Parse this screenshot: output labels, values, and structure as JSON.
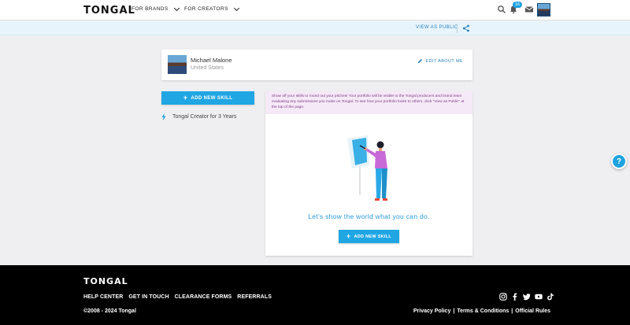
{
  "header": {
    "logo": "TONGAL",
    "menu_brands": "FOR BRANDS",
    "menu_creators": "FOR CREATORS",
    "notification_count": "16",
    "icons": [
      "search-icon",
      "bell-icon",
      "mail-icon",
      "user-avatar"
    ]
  },
  "public_bar": {
    "view_as_public": "VIEW AS PUBLIC",
    "share_icon": "share-icon"
  },
  "profile": {
    "name": "Michael Malone",
    "location": "United States",
    "edit_label": "EDIT ABOUT ME"
  },
  "sidebar": {
    "add_skill_label": "ADD NEW SKILL",
    "tenure": "Tongal Creator for 3 Years"
  },
  "portfolio": {
    "info_text": "Show off your skills to round out your pitches! Your portfolio will be visible to the Tongal producers and brand team evaluating any submissions you make on Tongal. To see how your portfolio looks to others, click \"View as Public\" at the top of the page.",
    "tagline": "Let's show the world what you can do.",
    "add_skill_label": "ADD NEW SKILL"
  },
  "help": {
    "label": "?"
  },
  "footer": {
    "logo": "TONGAL",
    "links": [
      "HELP CENTER",
      "GET IN TOUCH",
      "CLEARANCE FORMS",
      "REFERRALS"
    ],
    "copyright": "©2008 - 2024 Tongal",
    "legal": [
      "Privacy Policy",
      "Terms & Conditions",
      "Official Rules"
    ],
    "legal_separator": "|",
    "social_icons": [
      "instagram-icon",
      "facebook-icon",
      "twitter-icon",
      "youtube-icon",
      "tiktok-icon"
    ]
  },
  "colors": {
    "accent": "#20a6e3",
    "link": "#2a7fb8",
    "info_bg": "#f6e9f7",
    "info_text": "#7a3c84",
    "footer_bg": "#000000"
  }
}
